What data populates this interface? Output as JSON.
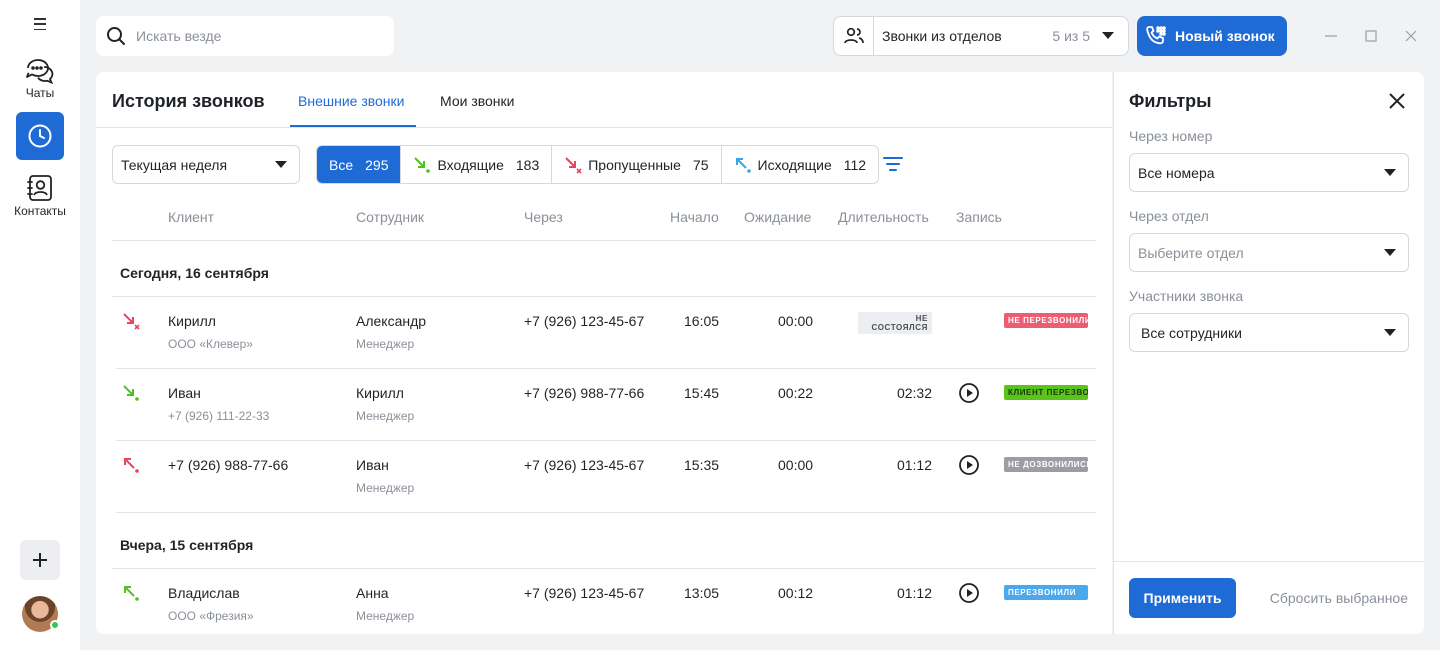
{
  "sidebar": {
    "items": [
      {
        "label": "Чаты",
        "icon": "chat-icon"
      },
      {
        "label": "Контакты",
        "icon": "contacts-icon"
      }
    ],
    "active_icon": "history-clock-icon"
  },
  "search": {
    "placeholder": "Искать везде"
  },
  "dept_filter": {
    "label": "Звонки из отделов",
    "count": "5 из 5"
  },
  "new_call": {
    "label": "Новый звонок"
  },
  "history": {
    "title": "История звонков",
    "tabs": [
      {
        "label": "Внешние звонки",
        "active": true
      },
      {
        "label": "Мои звонки",
        "active": false
      }
    ],
    "period": "Текущая неделя",
    "segments": [
      {
        "label": "Все",
        "count": "295",
        "active": true
      },
      {
        "label": "Входящие",
        "count": "183",
        "icon": "incoming-call-icon"
      },
      {
        "label": "Пропущенные",
        "count": "75",
        "icon": "missed-call-icon"
      },
      {
        "label": "Исходящие",
        "count": "112",
        "icon": "outgoing-call-icon"
      }
    ],
    "columns": [
      "Клиент",
      "Сотрудник",
      "Через",
      "Начало",
      "Ожидание",
      "Длительность",
      "Запись"
    ],
    "groups": [
      {
        "date": "Сегодня, 16 сентября",
        "rows": [
          {
            "type": "missed",
            "client": "Кирилл",
            "client_sub": "ООО «Клевер»",
            "employee": "Александр",
            "role": "Менеджер",
            "via": "+7 (926) 123-45-67",
            "start": "16:05",
            "wait": "00:00",
            "duration": "не состоялся",
            "status": "не перезвонили"
          },
          {
            "type": "incoming",
            "client": "Иван",
            "client_sub": "+7 (926) 111-22-33",
            "employee": "Кирилл",
            "role": "Менеджер",
            "via": "+7 (926) 988-77-66",
            "start": "15:45",
            "wait": "00:22",
            "duration": "02:32",
            "status": "клиент перезвонил"
          },
          {
            "type": "outgoing-failed",
            "client": "+7 (926) 988-77-66",
            "client_sub": "",
            "employee": "Иван",
            "role": "Менеджер",
            "via": "+7 (926) 123-45-67",
            "start": "15:35",
            "wait": "00:00",
            "duration": "01:12",
            "status": "не дозвонились"
          }
        ]
      },
      {
        "date": "Вчера, 15 сентября",
        "rows": [
          {
            "type": "outgoing",
            "client": "Владислав",
            "client_sub": "ООО «Фрезия»",
            "employee": "Анна",
            "role": "Менеджер",
            "via": "+7 (926) 123-45-67",
            "start": "13:05",
            "wait": "00:12",
            "duration": "01:12",
            "status": "перезвонили"
          }
        ]
      }
    ]
  },
  "filters": {
    "title": "Фильтры",
    "fields": [
      {
        "label": "Через номер",
        "value": "Все номера"
      },
      {
        "label": "Через отдел",
        "placeholder": "Выберите отдел"
      },
      {
        "label": "Участники звонка",
        "value": "Все сотрудники"
      }
    ],
    "apply": "Применить",
    "reset": "Сбросить выбранное"
  },
  "colors": {
    "accent": "#1f6bd6",
    "missed": "#e8445f",
    "incoming": "#4cc21a",
    "outgoing": "#3aa5e6",
    "tag_red": "#ec5d73",
    "tag_green": "#5bc41b",
    "tag_gray": "#9a9da2",
    "tag_blue": "#4aa8ec"
  }
}
